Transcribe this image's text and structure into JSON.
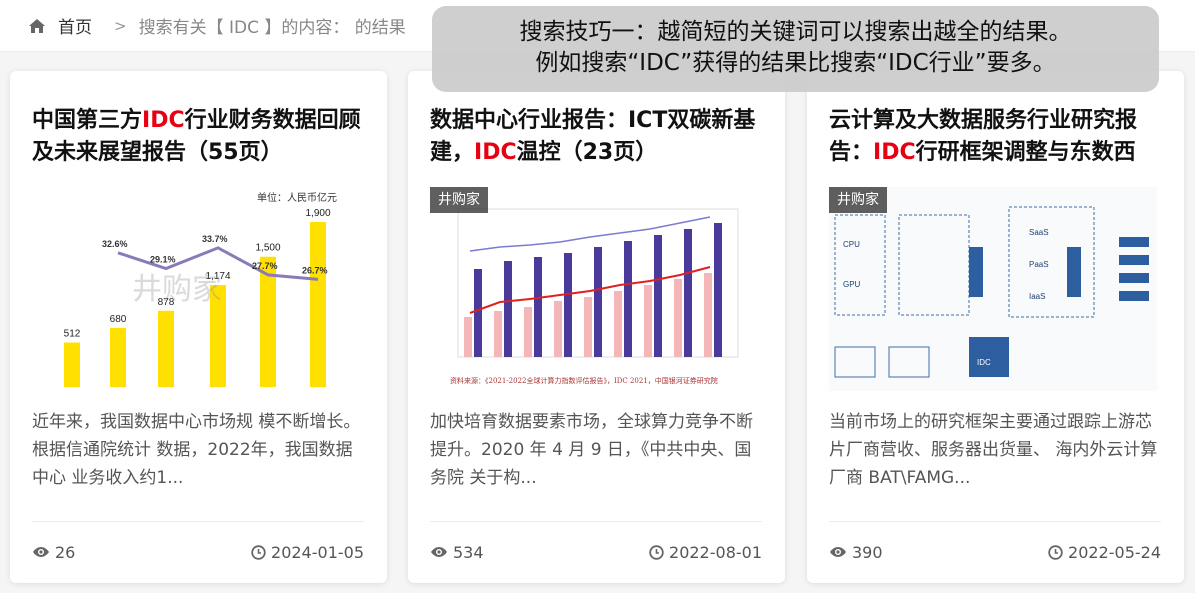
{
  "breadcrumb": {
    "home": "首页",
    "current": "搜索有关【 IDC 】的内容： 的结果",
    "separator": ">"
  },
  "tip": {
    "line1": "搜索技巧一：越简短的关键词可以搜索出越全的结果。",
    "line2": "例如搜索“IDC”获得的结果比搜索“IDC行业”要多。"
  },
  "cards": [
    {
      "title_pre": "中国第三方",
      "title_hl": "IDC",
      "title_post": "行业财务数据回顾及未来展望报告（55页）",
      "desc": "近年来，我国数据中心市场规 模不断增长。根据信通院统计 数据，2022年，我国数据中心 业务收入约1...",
      "views": "26",
      "date": "2024-01-05",
      "chart": {
        "unit": "单位：人民币亿元",
        "bar_labels": [
          "512",
          "680",
          "878",
          "1,174",
          "1,500",
          "1,900"
        ],
        "bar_values": [
          512,
          680,
          878,
          1174,
          1500,
          1900
        ],
        "line_labels": [
          "32.6%",
          "29.1%",
          "33.7%",
          "27.7%",
          "26.7%"
        ],
        "line_values": [
          32.6,
          29.1,
          33.7,
          27.7,
          26.7
        ],
        "watermark": "井购家"
      }
    },
    {
      "title_pre": "数据中心行业报告：ICT双碳新基建，",
      "title_hl": "IDC",
      "title_post": "温控（23页）",
      "desc": "加快培育数据要素市场，全球算力竞争不断提升。2020 年 4 月 9 日，《中共中央、国务院 关于构...",
      "views": "534",
      "date": "2022-08-01",
      "chart": {
        "watermark": "井购家",
        "caption": "资料来源：《2021-2022全球计算力指数评估报告》，IDC 2021，中国银河证券研究院"
      }
    },
    {
      "title_pre": "云计算及大数据服务行业研究报告：",
      "title_hl": "IDC",
      "title_post": "行研框架调整与东数西",
      "desc": "当前市场上的研究框架主要通过跟踪上游芯片厂商营收、服务器出货量、 海内外云计算厂商 BAT\\FAMG...",
      "views": "390",
      "date": "2022-05-24",
      "chart": {
        "watermark": "井购家",
        "labels": [
          "SaaS",
          "PaaS",
          "IaaS",
          "IDC",
          "CPU",
          "GPU"
        ]
      }
    }
  ],
  "colors": {
    "highlight": "#e60012",
    "bar_yellow": "#ffe000",
    "line_purple": "#8a7bb8"
  },
  "icons": {
    "home": "home-icon",
    "views": "eye-icon",
    "date": "clock-icon"
  }
}
